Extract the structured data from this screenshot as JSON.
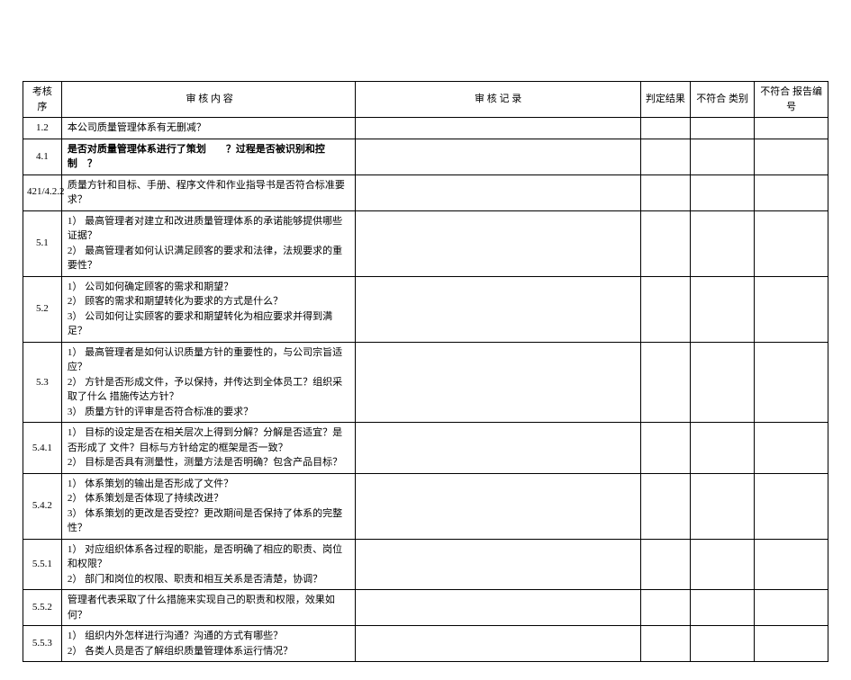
{
  "headers": {
    "seq": "考核 序",
    "content": "审 核 内 容",
    "record": "审 核 记 录",
    "result": "判定结果",
    "category": "不符合 类别",
    "reportId": "不符合 报告编号"
  },
  "rows": [
    {
      "seq": "1.2",
      "content": "本公司质量管理体系有无删减？",
      "bold": false
    },
    {
      "seq": "4.1",
      "content": "是否对质量管理体系进行了策划　　？过程是否被识别和控制　？",
      "bold": true
    },
    {
      "seq": "421/4.2.2",
      "content": "质量方针和目标、手册、程序文件和作业指导书是否符合标准要求？",
      "bold": false
    },
    {
      "seq": "5.1",
      "content": "1） 最高管理者对建立和改进质量管理体系的承诺能够提供哪些证据？\n2） 最高管理者如何认识满足顾客的要求和法律，法规要求的重要性？",
      "bold": false
    },
    {
      "seq": "5.2",
      "content": "1） 公司如何确定顾客的需求和期望？\n2） 顾客的需求和期望转化为要求的方式是什么？\n3） 公司如何让实顾客的要求和期望转化为相应要求并得到满足？",
      "bold": false
    },
    {
      "seq": "5.3",
      "content": "1） 最高管理者是如何认识质量方针的重要性的，与公司宗旨适应？\n2） 方针是否形成文件，予以保持，并传达到全体员工？组织采取了什么 措施传达方针？\n3） 质量方针的评审是否符合标准的要求？",
      "bold": false
    },
    {
      "seq": "5.4.1",
      "content": "1） 目标的设定是否在相关层次上得到分解？分解是否适宜？是否形成了 文件？目标与方针给定的框架是否一致？\n2） 目标是否具有测量性，测量方法是否明确？包含产品目标？",
      "bold": false
    },
    {
      "seq": "5.4.2",
      "content": "1） 体系策划的输出是否形成了文件？\n2） 体系策划是否体现了持续改进？\n3） 体系策划的更改是否受控？更改期间是否保持了体系的完整性？",
      "bold": false
    },
    {
      "seq": "5.5.1",
      "content": "1） 对应组织体系各过程的职能，是否明确了相应的职责、岗位和权限？\n2） 部门和岗位的权限、职责和相互关系是否清楚，协调？",
      "bold": false
    },
    {
      "seq": "5.5.2",
      "content": "管理者代表采取了什么措施来实现自己的职责和权限，效果如何？",
      "bold": false
    },
    {
      "seq": "5.5.3",
      "content": "1） 组织内外怎样进行沟通？沟通的方式有哪些？\n2） 各类人员是否了解组织质量管理体系运行情况？",
      "bold": false
    }
  ]
}
